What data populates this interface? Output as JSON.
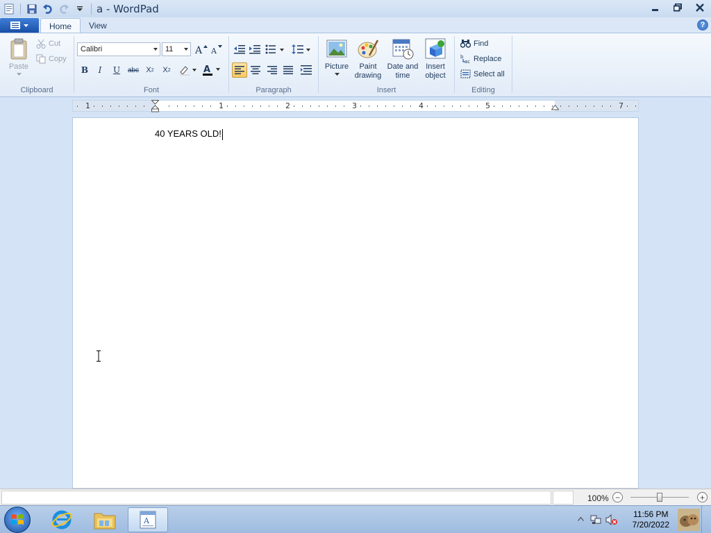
{
  "window": {
    "title": "a - WordPad"
  },
  "tabs": [
    {
      "label": "Home",
      "active": true
    },
    {
      "label": "View",
      "active": false
    }
  ],
  "clipboard": {
    "group_label": "Clipboard",
    "paste": "Paste",
    "cut": "Cut",
    "copy": "Copy"
  },
  "font": {
    "group_label": "Font",
    "family": "Calibri",
    "size": "11"
  },
  "paragraph": {
    "group_label": "Paragraph"
  },
  "insert": {
    "group_label": "Insert",
    "picture": "Picture",
    "paint_1": "Paint",
    "paint_2": "drawing",
    "date_1": "Date and",
    "date_2": "time",
    "object_1": "Insert",
    "object_2": "object"
  },
  "editing": {
    "group_label": "Editing",
    "find": "Find",
    "replace": "Replace",
    "select_all": "Select all"
  },
  "ruler": {
    "numbers": [
      "1",
      "1",
      "2",
      "3",
      "4",
      "5",
      "7"
    ]
  },
  "document": {
    "text": "40 YEARS OLD!"
  },
  "status": {
    "zoom": "100%"
  },
  "taskbar": {
    "time": "11:56 PM",
    "date": "7/20/2022"
  },
  "colors": {
    "accent": "#fbc85f",
    "ribbon_bg": "#f5f9fd",
    "workspace_bg": "#d4e3f5"
  }
}
